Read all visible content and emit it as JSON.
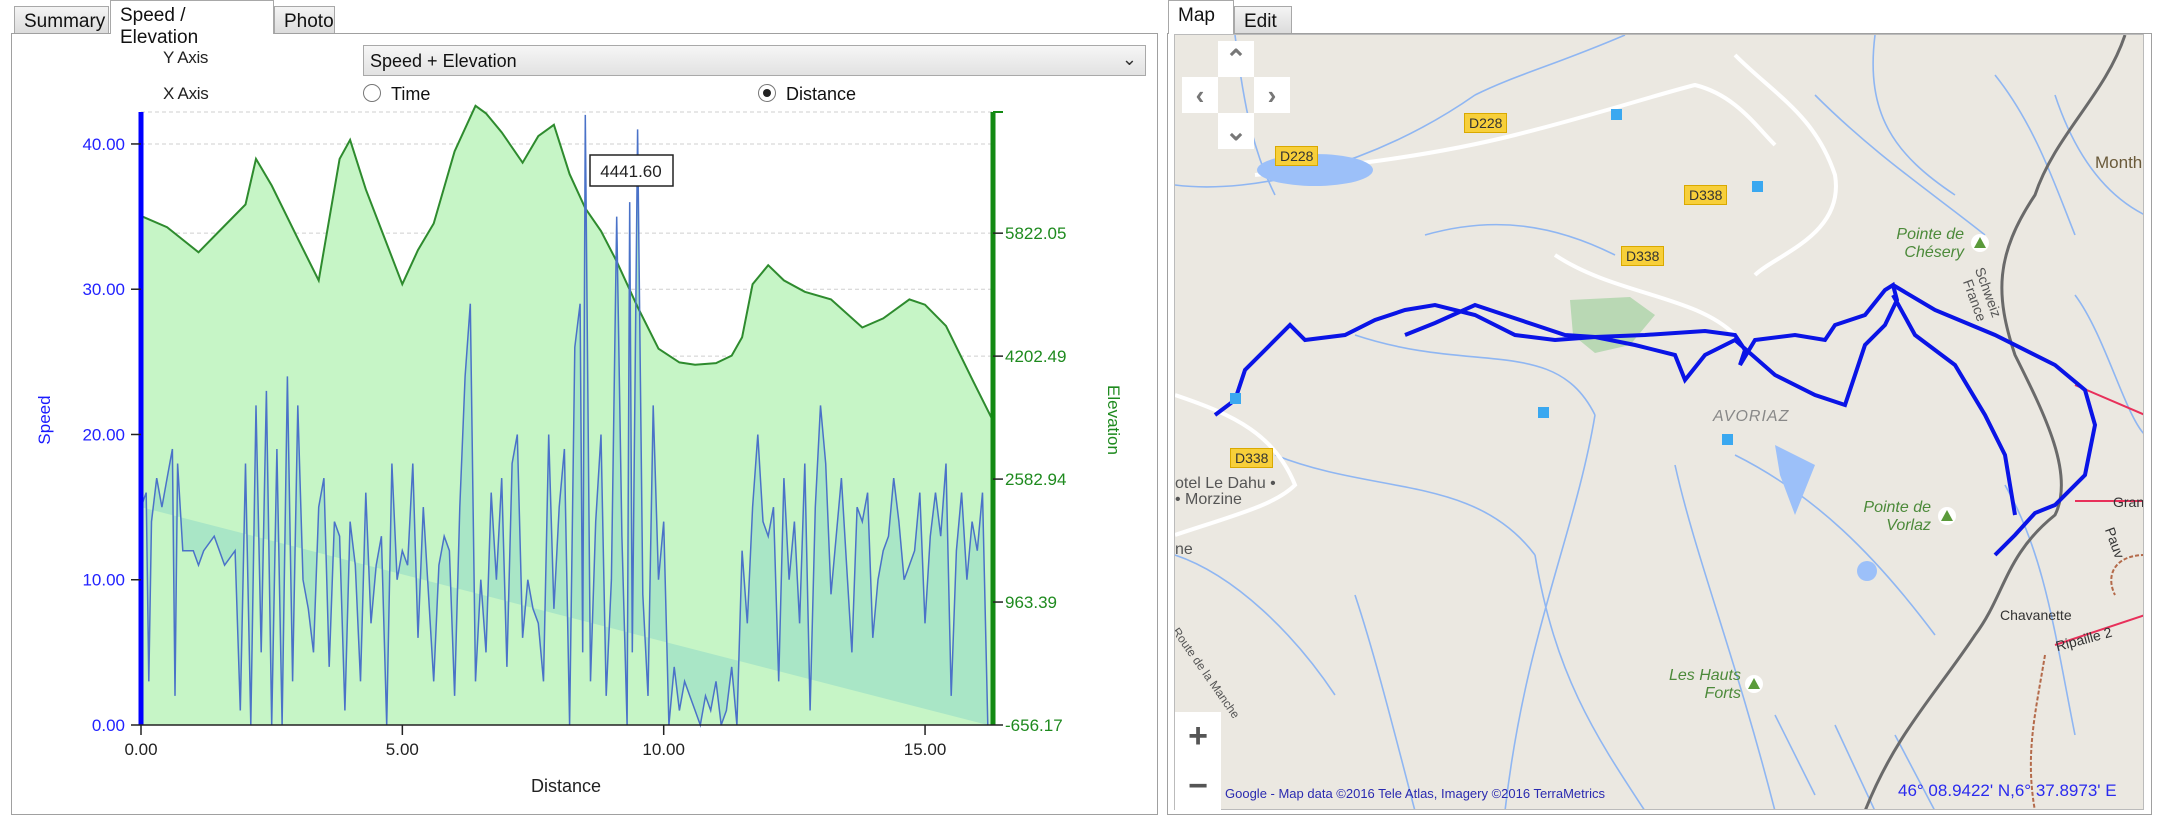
{
  "left_tabs": [
    {
      "label": "Summary",
      "active": false
    },
    {
      "label": "Speed / Elevation",
      "active": true
    },
    {
      "label": "Photo",
      "active": false
    }
  ],
  "controls": {
    "y_axis_label": "Y Axis",
    "y_axis_value": "Speed + Elevation",
    "x_axis_label": "X Axis",
    "x_axis_options": [
      {
        "label": "Time",
        "selected": false
      },
      {
        "label": "Distance",
        "selected": true
      }
    ]
  },
  "chart_data": {
    "type": "area",
    "title": "",
    "xlabel": "Distance",
    "ylabel": "Speed",
    "y2label": "Elevation",
    "xlim": [
      0,
      16.3
    ],
    "xticks": [
      "0.00",
      "5.00",
      "10.00",
      "15.00"
    ],
    "xtick_values": [
      0,
      5,
      10,
      15
    ],
    "ylim": [
      0,
      42.2
    ],
    "yticks": [
      "0.00",
      "10.00",
      "20.00",
      "30.00",
      "40.00"
    ],
    "ytick_values": [
      0,
      10,
      20,
      30,
      40
    ],
    "y2lim": [
      -656.17,
      7418
    ],
    "y2ticks": [
      "-656.17",
      "963.39",
      "2582.94",
      "4202.49",
      "5822.05"
    ],
    "y2tick_values": [
      -656.17,
      963.39,
      2582.94,
      4202.49,
      5822.05
    ],
    "grid": true,
    "tooltip": "4441.60",
    "series": [
      {
        "name": "Elevation",
        "axis": "right",
        "color": "#2e8b2e",
        "fill": "#c6f5c6",
        "x": [
          0,
          0.5,
          1.1,
          1.5,
          2.0,
          2.2,
          2.5,
          3.0,
          3.4,
          3.8,
          4.0,
          4.3,
          5.0,
          5.3,
          5.6,
          6.0,
          6.4,
          6.6,
          6.9,
          7.3,
          7.6,
          7.9,
          8.2,
          8.5,
          8.8,
          9.1,
          9.5,
          9.9,
          10.3,
          10.6,
          11.0,
          11.3,
          11.5,
          11.7,
          12.0,
          12.3,
          12.7,
          13.2,
          13.8,
          14.2,
          14.7,
          15.0,
          15.4,
          15.9,
          16.3
        ],
        "y": [
          6050,
          5900,
          5570,
          5850,
          6200,
          6800,
          6450,
          5750,
          5200,
          6800,
          7050,
          6400,
          5150,
          5600,
          5950,
          6900,
          7500,
          7400,
          7150,
          6750,
          7100,
          7250,
          6600,
          6150,
          5850,
          5450,
          4850,
          4300,
          4120,
          4090,
          4110,
          4210,
          4450,
          5150,
          5400,
          5200,
          5050,
          4950,
          4580,
          4700,
          4950,
          4880,
          4600,
          3900,
          3350
        ]
      },
      {
        "name": "Speed",
        "axis": "left",
        "color": "#4a72c8",
        "fill": "#a9e6c6",
        "x": [
          0,
          0.1,
          0.15,
          0.2,
          0.3,
          0.4,
          0.5,
          0.6,
          0.65,
          0.7,
          0.8,
          0.9,
          1.0,
          1.1,
          1.2,
          1.4,
          1.6,
          1.8,
          1.9,
          2.0,
          2.1,
          2.2,
          2.3,
          2.4,
          2.5,
          2.6,
          2.7,
          2.8,
          2.9,
          3.0,
          3.1,
          3.2,
          3.3,
          3.4,
          3.5,
          3.6,
          3.7,
          3.8,
          3.9,
          4.0,
          4.1,
          4.2,
          4.3,
          4.4,
          4.5,
          4.6,
          4.7,
          4.8,
          4.9,
          5.0,
          5.1,
          5.2,
          5.3,
          5.4,
          5.5,
          5.6,
          5.7,
          5.8,
          5.9,
          6.0,
          6.1,
          6.2,
          6.3,
          6.4,
          6.5,
          6.6,
          6.7,
          6.8,
          6.9,
          7.0,
          7.1,
          7.2,
          7.3,
          7.4,
          7.5,
          7.6,
          7.7,
          7.8,
          7.9,
          8.0,
          8.1,
          8.2,
          8.3,
          8.4,
          8.45,
          8.5,
          8.6,
          8.7,
          8.8,
          8.9,
          9.0,
          9.1,
          9.2,
          9.3,
          9.35,
          9.4,
          9.5,
          9.6,
          9.7,
          9.8,
          9.9,
          10.0,
          10.1,
          10.2,
          10.3,
          10.4,
          10.5,
          10.6,
          10.7,
          10.8,
          10.9,
          11.0,
          11.1,
          11.2,
          11.3,
          11.4,
          11.5,
          11.6,
          11.7,
          11.8,
          11.9,
          12.0,
          12.1,
          12.2,
          12.3,
          12.4,
          12.5,
          12.6,
          12.7,
          12.8,
          12.9,
          13.0,
          13.1,
          13.2,
          13.3,
          13.4,
          13.5,
          13.6,
          13.7,
          13.8,
          13.9,
          14.0,
          14.1,
          14.2,
          14.3,
          14.4,
          14.5,
          14.6,
          14.7,
          14.8,
          14.9,
          15.0,
          15.1,
          15.2,
          15.3,
          15.4,
          15.5,
          15.6,
          15.7,
          15.8,
          15.9,
          16.0,
          16.1,
          16.2,
          16.3
        ],
        "y": [
          15,
          16,
          3,
          14,
          17,
          15,
          17,
          19,
          2,
          18,
          12,
          12,
          12,
          11,
          12,
          13,
          11,
          12,
          1,
          18,
          0,
          22,
          5,
          23,
          0,
          19,
          0,
          24,
          3,
          22,
          10,
          8,
          5,
          15,
          17,
          4,
          14,
          13,
          1,
          14,
          11,
          3,
          16,
          7,
          11,
          13,
          0,
          18,
          10,
          12,
          11,
          18,
          6,
          15,
          9,
          3,
          11,
          13,
          12,
          2,
          15,
          24,
          29,
          3,
          10,
          5,
          16,
          10,
          17,
          4,
          18,
          20,
          6,
          10,
          8,
          7,
          3,
          20,
          8,
          15,
          19,
          0,
          26,
          29,
          5,
          42,
          3,
          14,
          20,
          2,
          10,
          35,
          13,
          0,
          36,
          5,
          41,
          9,
          2,
          22,
          10,
          14,
          0,
          4,
          1,
          3,
          2,
          1,
          0,
          2,
          1,
          3,
          0,
          1,
          4,
          0,
          12,
          7,
          15,
          20,
          14,
          13,
          15,
          3,
          17,
          10,
          14,
          7,
          18,
          1,
          15,
          22,
          18,
          9,
          13,
          17,
          11,
          5,
          15,
          14,
          16,
          6,
          10,
          12,
          13,
          17,
          14,
          10,
          11,
          12,
          16,
          7,
          13,
          16,
          13,
          18,
          2,
          12,
          16,
          10,
          14,
          12,
          16,
          0
        ]
      }
    ]
  },
  "right_tabs": [
    {
      "label": "Map",
      "active": true
    },
    {
      "label": "Edit",
      "active": false
    }
  ],
  "map": {
    "nav": {
      "up": "chevron-up",
      "down": "chevron-down",
      "left": "chevron-left",
      "right": "chevron-right"
    },
    "zoom_in": "+",
    "zoom_out": "−",
    "road_signs": [
      "D228",
      "D228",
      "D338",
      "D338",
      "D338"
    ],
    "places": {
      "hotel": "otel Le Dahu •",
      "morzine": "• Morzine",
      "ne": "ne",
      "avoriaz": "AVORIAZ",
      "month": "Month",
      "schweiz": "Schweiz",
      "france": "France",
      "route": "Route de la Manche",
      "chavanette": "Chavanette",
      "ripaille": "Ripaille 2",
      "grand": "Gran",
      "pauv": "Pauv"
    },
    "peaks": [
      {
        "line1": "Pointe de",
        "line2": "Chésery"
      },
      {
        "line1": "Pointe de",
        "line2": "Vorlaz"
      },
      {
        "line1": "Les Hauts",
        "line2": "Forts"
      }
    ],
    "attribution": "Google - Map data ©2016 Tele Atlas, Imagery ©2016 TerraMetrics",
    "coordinates": "46° 08.9422' N,6° 37.8973' E",
    "track_color": "#0a14e6"
  }
}
